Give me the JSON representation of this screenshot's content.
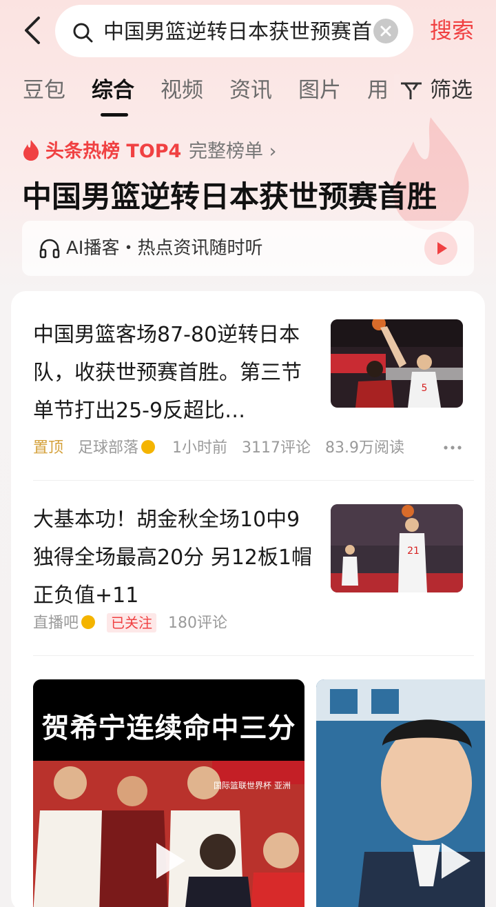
{
  "search": {
    "query": "中国男篮逆转日本获世预赛首",
    "submit_label": "搜索"
  },
  "tabs": [
    {
      "label": "豆包"
    },
    {
      "label": "综合"
    },
    {
      "label": "视频"
    },
    {
      "label": "资讯"
    },
    {
      "label": "图片"
    },
    {
      "label": "用"
    }
  ],
  "active_tab": "综合",
  "filter_label": "筛选",
  "hot": {
    "rank_label": "头条热榜 TOP4",
    "full_list_label": "完整榜单 ›",
    "title": "中国男篮逆转日本获世预赛首胜"
  },
  "podcast": {
    "label": "AI播客・热点资讯随时听"
  },
  "results": [
    {
      "title": "中国男篮客场87-80逆转日本队，收获世预赛首胜。第三节单节打出25-9反超比…",
      "pinned_label": "置顶",
      "source": "足球部落",
      "time": "1小时前",
      "comments": "3117评论",
      "reads": "83.9万阅读"
    },
    {
      "title": "大基本功！胡金秋全场10中9独得全场最高20分 另12板1帽正负值+11",
      "source": "直播吧",
      "followed_label": "已关注",
      "comments": "180评论"
    }
  ],
  "videos": [
    {
      "caption": "贺希宁连续命中三分",
      "overlay": "国际篮联世界杯 亚洲"
    },
    {
      "caption": ""
    }
  ],
  "colors": {
    "accent": "#f04142",
    "pinned": "#d4a13b",
    "verified": "#f4b400"
  }
}
